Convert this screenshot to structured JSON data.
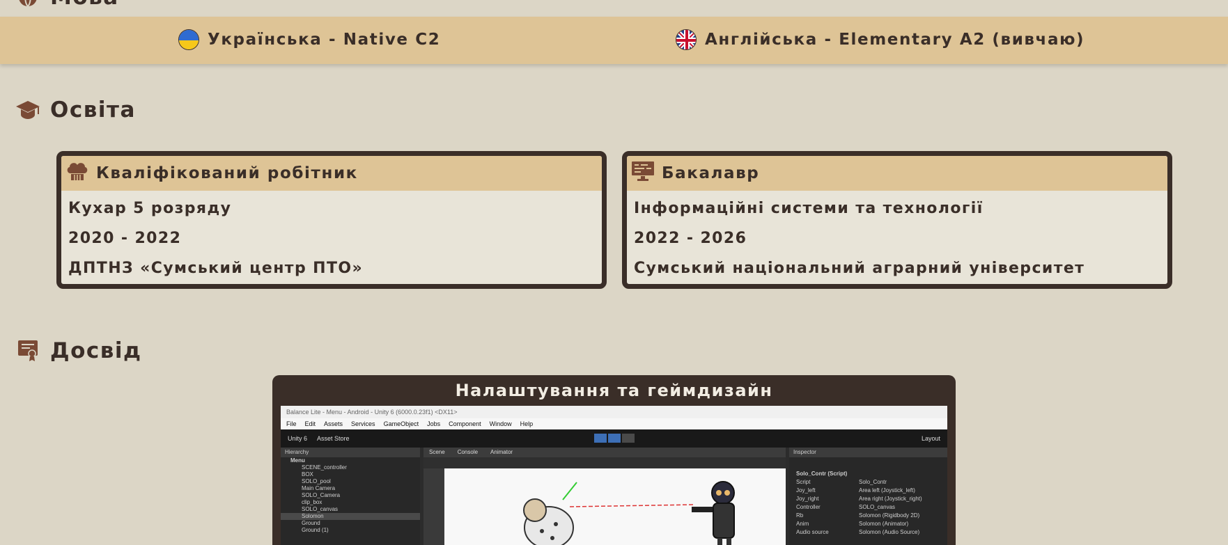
{
  "languages": {
    "section_title": "Мова",
    "items": [
      {
        "label": "Українська - Native C2",
        "flag": "ukraine-flag-icon"
      },
      {
        "label": "Англійська - Elementary A2 (вивчаю)",
        "flag": "uk-flag-icon"
      }
    ]
  },
  "education": {
    "section_title": "Освіта",
    "cards": [
      {
        "title": "Кваліфікований робітник",
        "icon": "chef-hat-icon",
        "specialty": "Кухар 5 розряду",
        "years": "2020 - 2022",
        "institution": "ДПТНЗ «Сумський центр ПТО»"
      },
      {
        "title": "Бакалавр",
        "icon": "computer-monitor-icon",
        "specialty": "Інформаційні системи та технології",
        "years": "2022 - 2026",
        "institution": "Сумський національний аграрний університет"
      }
    ]
  },
  "experience": {
    "section_title": "Досвід",
    "card_title": "Налаштування та геймдизайн",
    "screenshot": {
      "window_title": "Balance Lite - Menu - Android - Unity 6 (6000.0.23f1) <DX11>",
      "menu": [
        "File",
        "Edit",
        "Assets",
        "Services",
        "GameObject",
        "Jobs",
        "Component",
        "Window",
        "Help"
      ],
      "toolbar": [
        "Unity 6",
        "Asset Store",
        "Layout"
      ],
      "hierarchy_title": "Hierarchy",
      "hierarchy_root": "Menu",
      "hierarchy_items": [
        "SCENE_controller",
        "BOX",
        "SOLO_pool",
        "Main Camera",
        "SOLO_Camera",
        "clip_box",
        "SOLO_canvas",
        "Solomon",
        "Ground",
        "Ground (1)"
      ],
      "scene_tabs": [
        "Scene",
        "Console",
        "Animator"
      ],
      "inspector_title": "Inspector",
      "inspector_component": "Solo_Contr (Script)",
      "inspector_rows": [
        {
          "k": "Script",
          "v": "Solo_Contr"
        },
        {
          "k": "Joy_left",
          "v": "Area left (Joystick_left)"
        },
        {
          "k": "Joy_right",
          "v": "Area right (Joystick_right)"
        },
        {
          "k": "Controller",
          "v": "SOLO_canvas"
        },
        {
          "k": "Rb",
          "v": "Solomon (Rigidbody 2D)"
        },
        {
          "k": "Anim",
          "v": "Solomon (Animator)"
        },
        {
          "k": "Audio source",
          "v": "Solomon (Audio Source)"
        }
      ]
    }
  },
  "colors": {
    "background": "#dcd6c6",
    "accent_bar": "#dec496",
    "dark": "#3a2e28",
    "card_body": "#e8e4d8"
  }
}
